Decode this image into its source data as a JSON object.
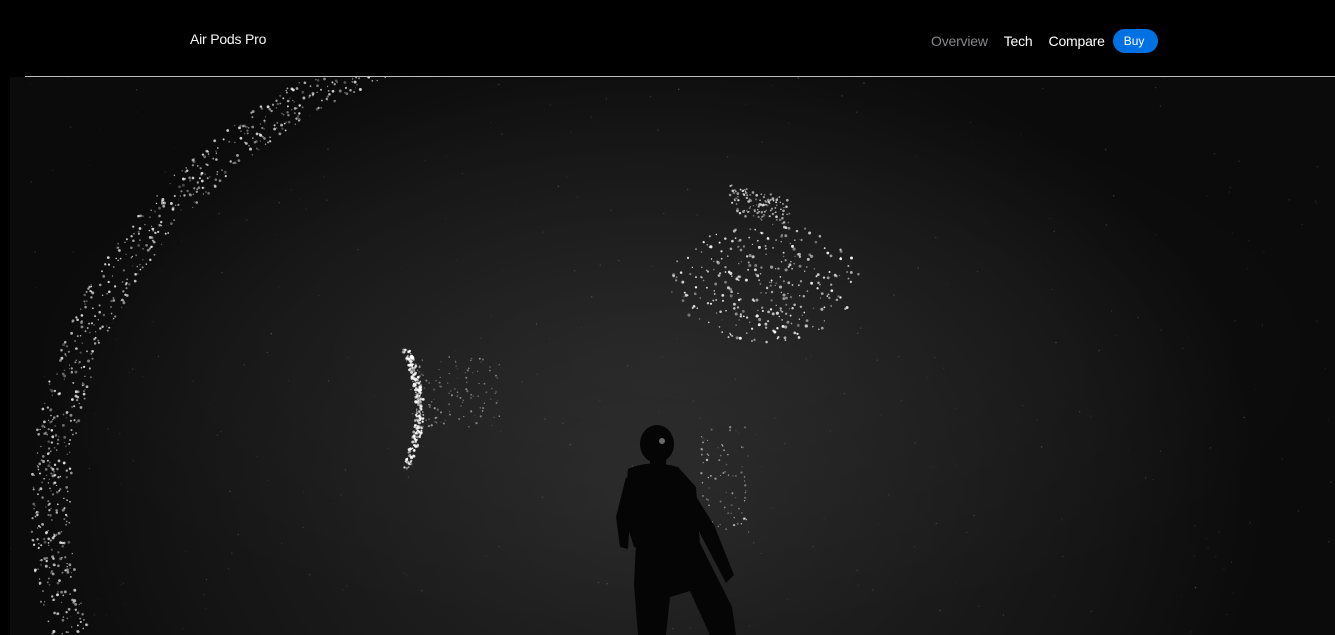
{
  "nav": {
    "brand": "Air Pods Pro",
    "links": [
      "Overview",
      "Tech",
      "Compare"
    ],
    "buy_label": "Buy"
  },
  "hero": {
    "image": "dark-stage-particles-dancer"
  },
  "colors": {
    "background": "#000000",
    "accent": "#0071e3",
    "muted_link": "#86868b",
    "text": "#ffffff"
  }
}
